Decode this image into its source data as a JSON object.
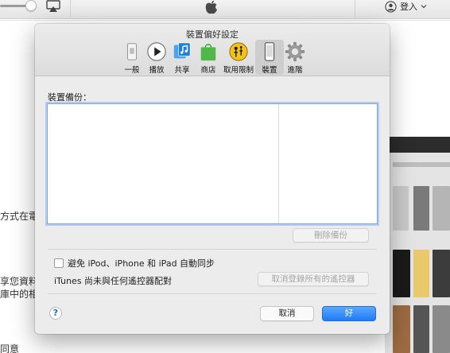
{
  "background_window": {
    "account_label": "登入",
    "partial_text_1": "方式在電",
    "partial_text_2": "享您資料",
    "partial_text_3": "庫中的相",
    "partial_text_4": "同意"
  },
  "preferences": {
    "title": "裝置偏好設定",
    "tabs": [
      {
        "label": "一般",
        "icon": "general-switch-icon"
      },
      {
        "label": "播放",
        "icon": "playback-icon"
      },
      {
        "label": "共享",
        "icon": "sharing-icon"
      },
      {
        "label": "商店",
        "icon": "store-bag-icon"
      },
      {
        "label": "取用限制",
        "icon": "parental-icon"
      },
      {
        "label": "裝置",
        "icon": "device-icon",
        "active": true
      },
      {
        "label": "進階",
        "icon": "gear-icon"
      }
    ],
    "backups_label": "裝置備份：",
    "delete_backup": "刪除備份",
    "prevent_sync_label": "避免 iPod、iPhone 和 iPad 自動同步",
    "prevent_sync_checked": false,
    "remotes_text": "iTunes 尚未與任何遙控器配對",
    "forget_remotes": "取消登錄所有的遙控器",
    "help": "?",
    "cancel": "取消",
    "ok": "好"
  },
  "colors": {
    "accent_blue": "#1f7cf4",
    "store_green": "#4fb848",
    "parental_yellow": "#f4c21b",
    "sharing_blue": "#1d7fe0"
  }
}
